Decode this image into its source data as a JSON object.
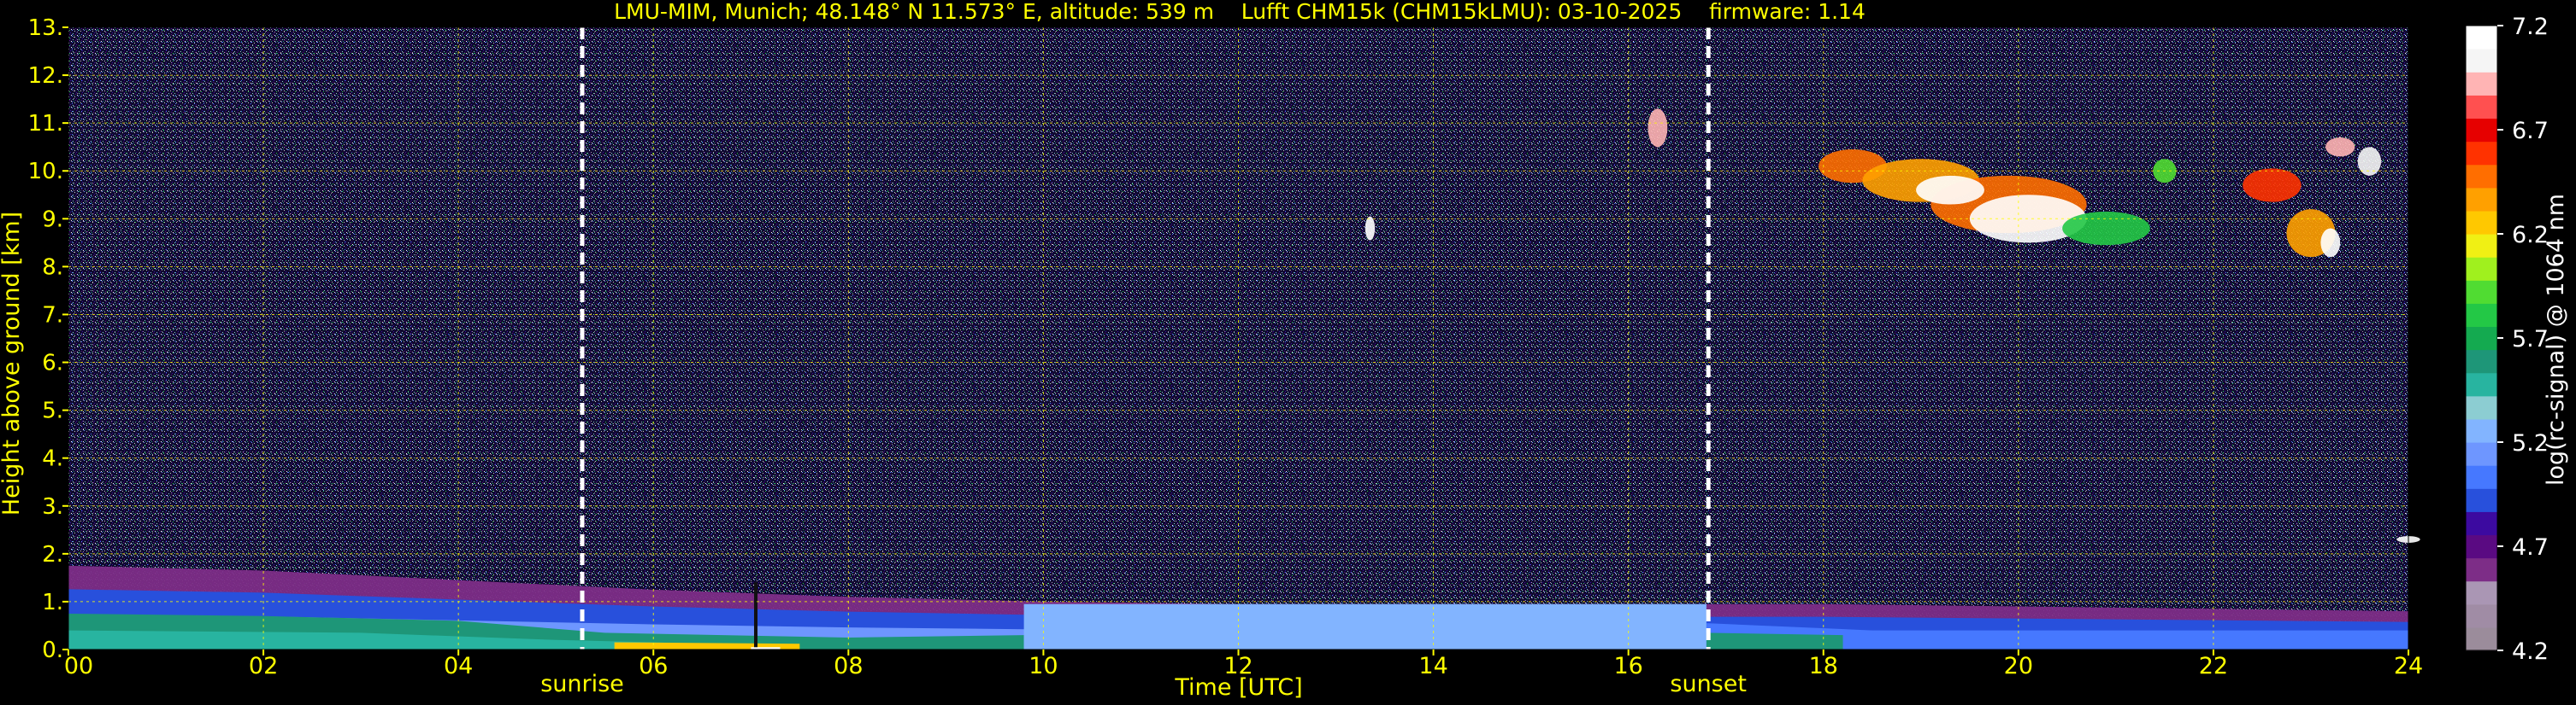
{
  "chart_data": {
    "type": "heatmap",
    "title": "LMU-MIM, Munich; 48.148° N 11.573° E, altitude: 539 m    Lufft CHM15k (CHM15kLMU): 03-10-2025    firmware: 1.14",
    "xlabel": "Time [UTC]",
    "ylabel": "Height above ground [km]",
    "colorbar_label": "log(rc-signal) @ 1064 nm",
    "xlim": [
      0,
      24
    ],
    "ylim": [
      0,
      13
    ],
    "x_ticks": [
      "00",
      "02",
      "04",
      "06",
      "08",
      "10",
      "12",
      "14",
      "16",
      "18",
      "20",
      "22",
      "24"
    ],
    "x_tick_values": [
      0,
      2,
      4,
      6,
      8,
      10,
      12,
      14,
      16,
      18,
      20,
      22,
      24
    ],
    "y_ticks": [
      "0.",
      "1.",
      "2.",
      "3.",
      "4.",
      "5.",
      "6.",
      "7.",
      "8.",
      "9.",
      "10.",
      "11.",
      "12.",
      "13."
    ],
    "y_tick_values": [
      0,
      1,
      2,
      3,
      4,
      5,
      6,
      7,
      8,
      9,
      10,
      11,
      12,
      13
    ],
    "clim": [
      4.2,
      7.2
    ],
    "colorbar_ticks": [
      "4.2",
      "4.7",
      "5.2",
      "5.7",
      "6.2",
      "6.7",
      "7.2"
    ],
    "colorbar_tick_values": [
      4.2,
      4.7,
      5.2,
      5.7,
      6.2,
      6.7,
      7.2
    ],
    "colormap": [
      "#9b8c9b",
      "#a08ca5",
      "#aa96b4",
      "#7d2d87",
      "#5a0a82",
      "#3c0aa0",
      "#2850dc",
      "#4678ff",
      "#6e96ff",
      "#82b4ff",
      "#8ccdd2",
      "#28b4a0",
      "#1e9678",
      "#14aa50",
      "#23c846",
      "#50dc32",
      "#a0f01e",
      "#f0f014",
      "#ffc800",
      "#ffa000",
      "#ff6e00",
      "#ff3200",
      "#e60000",
      "#ff5050",
      "#ffb4b4",
      "#f5f5f5",
      "#ffffff"
    ],
    "markers": [
      {
        "label": "sunrise",
        "x": 5.27
      },
      {
        "label": "sunset",
        "x": 16.82
      }
    ],
    "features": [
      {
        "name": "boundary layer aerosol top (km)",
        "x": [
          0,
          2,
          4,
          6,
          8,
          10,
          12,
          14,
          16,
          18,
          20,
          22,
          24
        ],
        "y": [
          1.75,
          1.65,
          1.45,
          1.25,
          1.1,
          1.0,
          0.95,
          0.95,
          0.95,
          0.95,
          0.9,
          0.85,
          0.8
        ]
      },
      {
        "name": "cirrus cloud base/top (km)",
        "x_range": [
          17.9,
          24
        ],
        "y_range": [
          8.0,
          11.0
        ]
      }
    ],
    "grid": true,
    "grid_color": "#ffff00"
  }
}
